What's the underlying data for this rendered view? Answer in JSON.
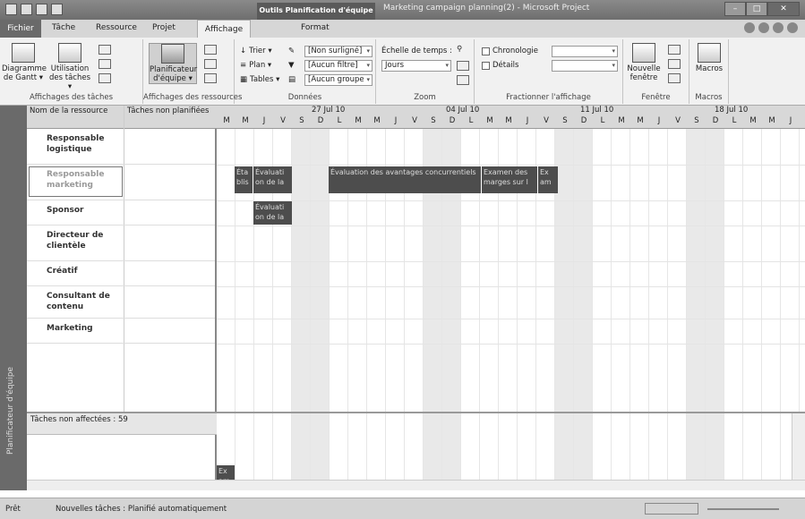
{
  "title_bar": {
    "tools_tab": "Outils Planification d'équipe",
    "title": "Marketing campaign planning(2) - Microsoft Project"
  },
  "tabs": {
    "file": "Fichier",
    "task": "Tâche",
    "resource": "Ressource",
    "project": "Projet",
    "view": "Affichage",
    "format": "Format"
  },
  "ribbon": {
    "task_views": {
      "gantt": "Diagramme de Gantt ▾",
      "usage": "Utilisation des tâches ▾",
      "label": "Affichages des tâches"
    },
    "resource_views": {
      "planner": "Planificateur d'équipe ▾",
      "label": "Affichages des ressources"
    },
    "data": {
      "sort": "Trier ▾",
      "outline": "Plan ▾",
      "tables": "Tables ▾",
      "highlight": "[Non surligné]",
      "filter": "[Aucun filtre]",
      "group": "[Aucun groupe",
      "label": "Données"
    },
    "zoom": {
      "timescale": "Échelle de temps :",
      "timescale_value": "Jours",
      "label": "Zoom"
    },
    "split": {
      "timeline": "Chronologie",
      "details": "Détails",
      "label": "Fractionner l'affichage"
    },
    "window": {
      "new_window": "Nouvelle fenêtre",
      "label": "Fenêtre"
    },
    "macros": {
      "macros": "Macros",
      "label": "Macros"
    }
  },
  "sidebar": {
    "label": "Planificateur d'équipe"
  },
  "table": {
    "col_name": "Nom de la ressource",
    "col_unassigned": "Tâches non planifiées",
    "resources": [
      {
        "name": "Responsable logistique"
      },
      {
        "name": "Responsable marketing"
      },
      {
        "name": "Sponsor"
      },
      {
        "name": "Directeur de clientèle"
      },
      {
        "name": "Créatif"
      },
      {
        "name": "Consultant de contenu"
      },
      {
        "name": "Marketing"
      }
    ]
  },
  "timeline": {
    "weeks": [
      "27 Jul 10",
      "04 Jul 10",
      "11 Jul 10",
      "18 Jul 10"
    ],
    "days": [
      "M",
      "M",
      "J",
      "V",
      "S",
      "D",
      "L",
      "M",
      "M",
      "J",
      "V",
      "S",
      "D",
      "L",
      "M",
      "M",
      "J",
      "V",
      "S",
      "D",
      "L",
      "M",
      "M",
      "J",
      "V",
      "S",
      "D",
      "L",
      "M",
      "M",
      "J"
    ],
    "tasks": [
      {
        "text": "Éta blis"
      },
      {
        "text": "Évaluati on de la"
      },
      {
        "text": "Évaluation des avantages concurrentiels"
      },
      {
        "text": "Examen des marges sur l"
      },
      {
        "text": "Ex am"
      },
      {
        "text": "Évaluati on de la"
      }
    ]
  },
  "unassigned": {
    "title": "Tâches non affectées : 59",
    "task": "Ex am"
  },
  "status": {
    "ready": "Prêt",
    "new_tasks": "Nouvelles tâches : Planifié automatiquement"
  }
}
